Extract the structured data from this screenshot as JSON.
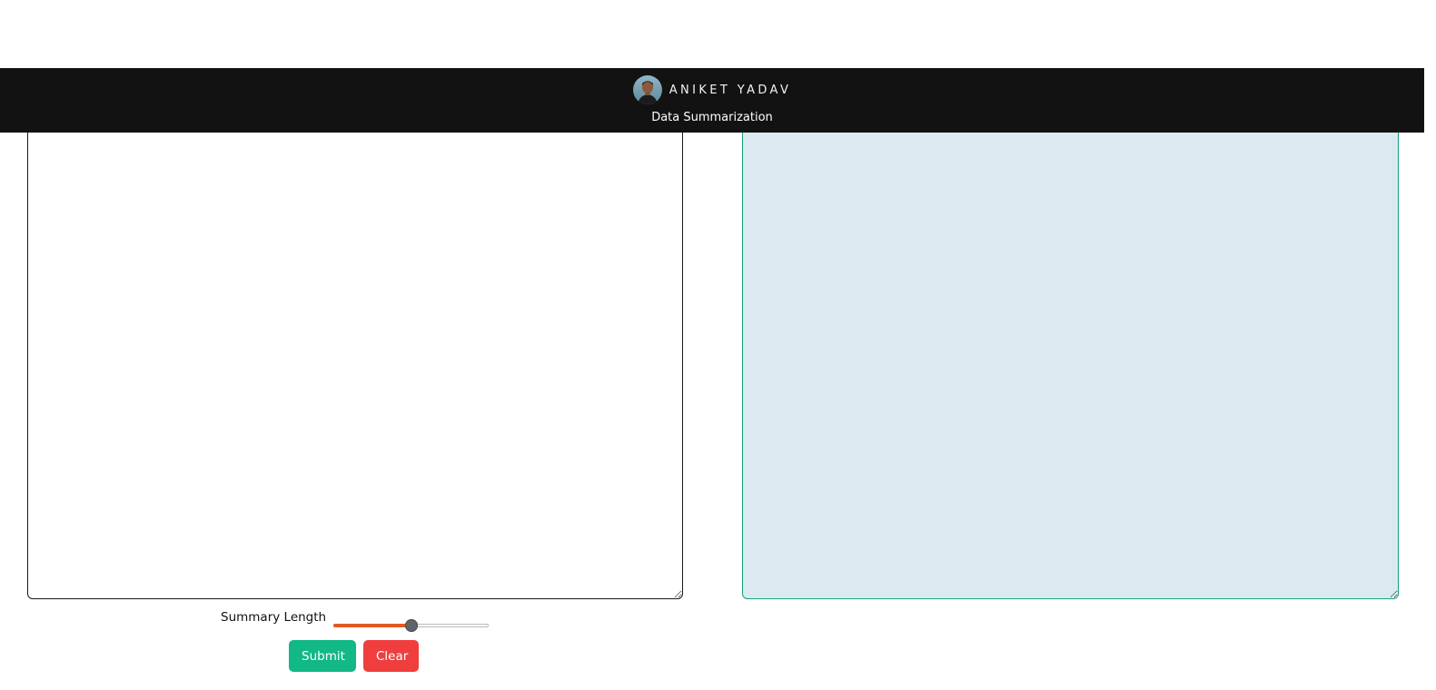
{
  "header": {
    "brand_name": "ANIKET YADAV",
    "subtitle": "Data Summarization",
    "avatar_icon": "profile-photo"
  },
  "input_panel": {
    "value": "",
    "placeholder": ""
  },
  "output_panel": {
    "value": ""
  },
  "controls": {
    "slider_label": "Summary Length",
    "slider_value_fraction": 0.5
  },
  "buttons": {
    "submit_label": "Submit",
    "clear_label": "Clear"
  },
  "colors": {
    "header_bg": "#121212",
    "output_bg": "#daeaf0",
    "output_border": "#14a07a",
    "slider_fill": "#e15a24",
    "submit_bg": "#12b886",
    "clear_bg": "#f03e3e"
  }
}
